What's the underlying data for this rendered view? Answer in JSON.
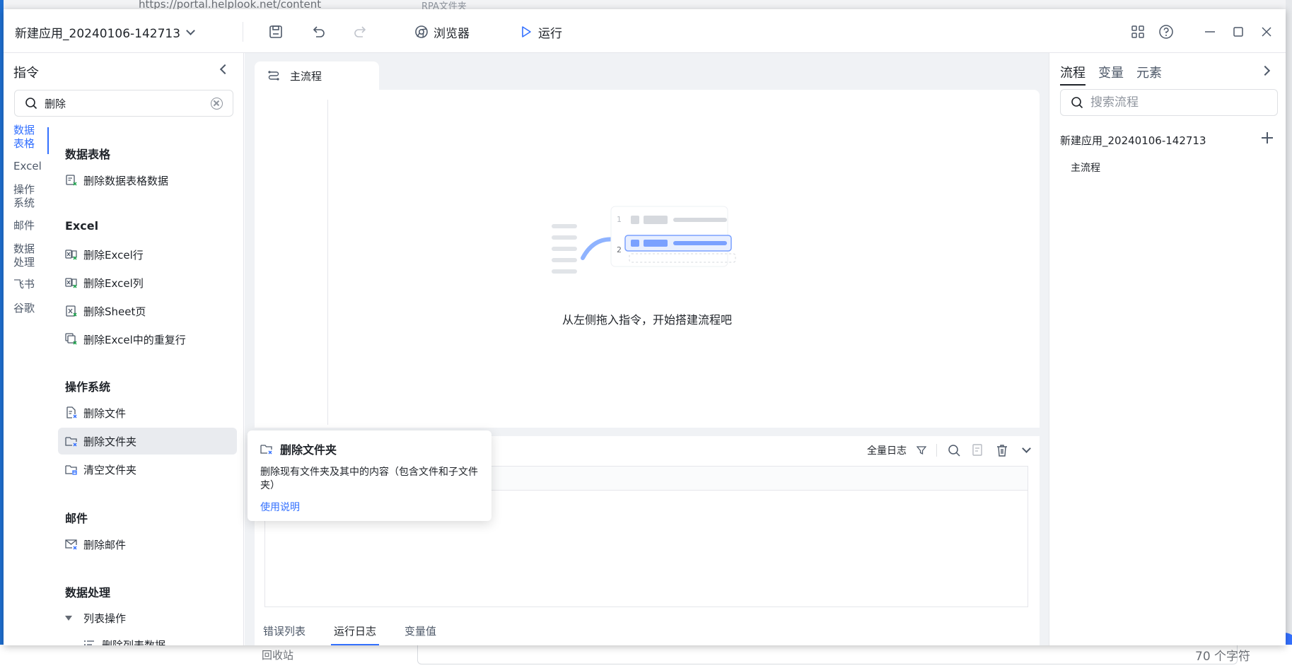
{
  "background": {
    "url_fragment": "https://portal.helplook.net/content",
    "tab_fragment": "RPA文件夹",
    "recycle_bin": "回收站",
    "char_count": "70 个字符"
  },
  "titlebar": {
    "app_title": "新建应用_20240106-142713",
    "browser_label": "浏览器",
    "run_label": "运行"
  },
  "left_panel": {
    "header": "指令",
    "search_value": "删除",
    "categories": [
      {
        "label": "数据\n表格",
        "active": true
      },
      {
        "label": "Excel",
        "active": false
      },
      {
        "label": "操作\n系统",
        "active": false
      },
      {
        "label": "邮件",
        "active": false
      },
      {
        "label": "数据\n处理",
        "active": false
      },
      {
        "label": "飞书",
        "active": false
      },
      {
        "label": "谷歌",
        "active": false
      }
    ],
    "groups": {
      "datatable": {
        "title": "数据表格",
        "items": [
          "删除数据表格数据"
        ]
      },
      "excel": {
        "title": "Excel",
        "items": [
          "删除Excel行",
          "删除Excel列",
          "删除Sheet页",
          "删除Excel中的重复行"
        ]
      },
      "os": {
        "title": "操作系统",
        "items": [
          "删除文件",
          "删除文件夹",
          "清空文件夹"
        ]
      },
      "mail": {
        "title": "邮件",
        "items": [
          "删除邮件"
        ]
      },
      "dataproc": {
        "title": "数据处理",
        "sub": "列表操作",
        "items": [
          "删除列表数据"
        ]
      }
    }
  },
  "center": {
    "main_tab": "主流程",
    "empty_text": "从左侧拖入指令，开始搭建流程吧",
    "log_filter": "全量日志",
    "bottom_tabs": [
      "错误列表",
      "运行日志",
      "变量值"
    ],
    "active_bottom_tab": "运行日志"
  },
  "tooltip": {
    "title": "删除文件夹",
    "description": "删除现有文件夹及其中的内容（包含文件和子文件夹）",
    "link": "使用说明"
  },
  "right_panel": {
    "tabs": [
      "流程",
      "变量",
      "元素"
    ],
    "active_tab": "流程",
    "search_placeholder": "搜索流程",
    "app_name": "新建应用_20240106-142713",
    "flow_item": "主流程"
  },
  "colors": {
    "accent": "#3370ff",
    "text": "#1f2329",
    "muted": "#4e5969",
    "danger_mark": "#3370ff",
    "excel_mark": "#1aa34a"
  }
}
